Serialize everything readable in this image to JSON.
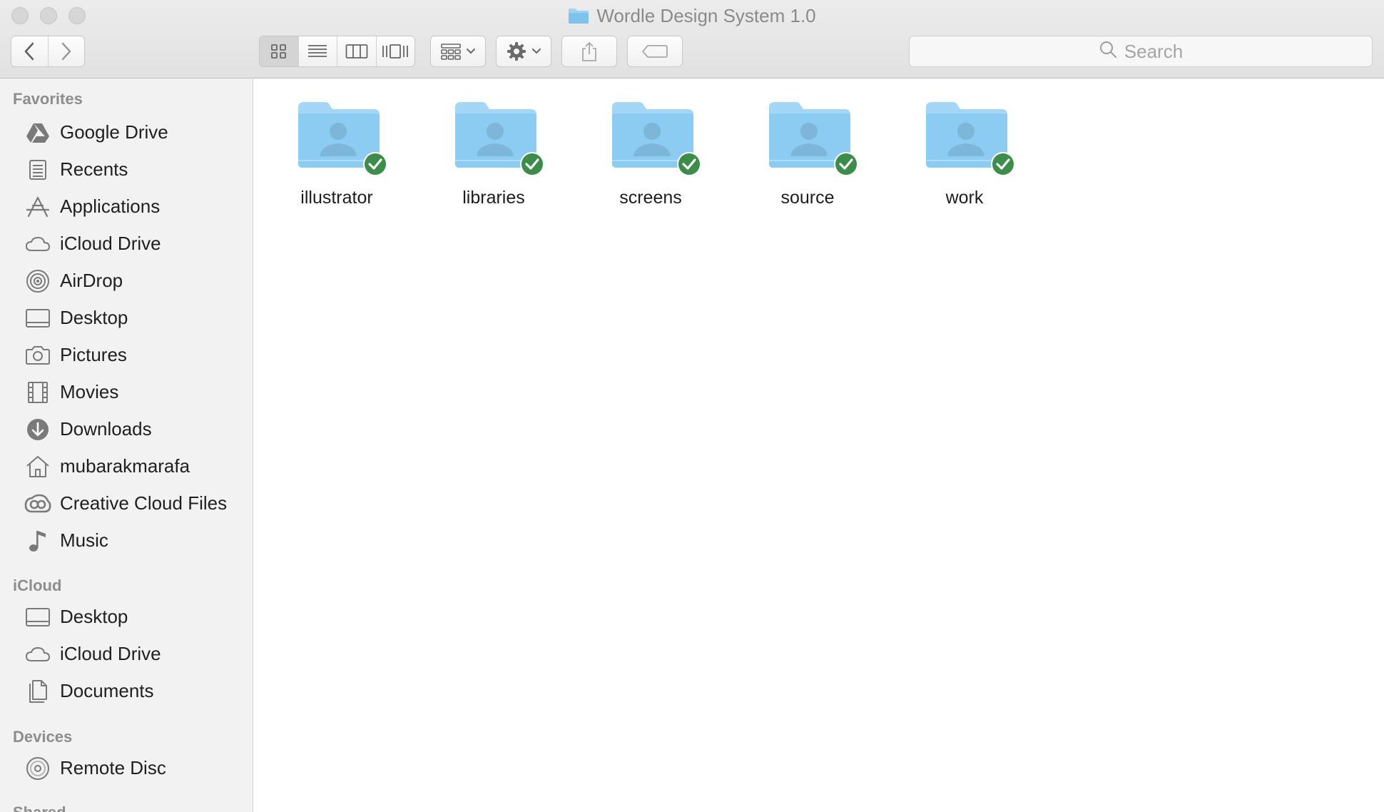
{
  "window": {
    "title": "Wordle Design System 1.0",
    "title_icon": "folder-icon"
  },
  "toolbar": {
    "back_icon": "chevron-left-icon",
    "forward_icon": "chevron-right-icon",
    "views": [
      "icon-view",
      "list-view",
      "column-view",
      "cover-flow-view"
    ],
    "active_view": "icon-view",
    "arrange_icon": "arrange-grid-icon",
    "action_icon": "gear-icon",
    "share_icon": "share-icon",
    "tag_icon": "tag-icon"
  },
  "search": {
    "placeholder": "Search"
  },
  "sidebar": {
    "favorites_title": "Favorites",
    "favorites": [
      {
        "label": "Google Drive",
        "icon": "google-drive-icon"
      },
      {
        "label": "Recents",
        "icon": "recents-icon"
      },
      {
        "label": "Applications",
        "icon": "applications-icon"
      },
      {
        "label": "iCloud Drive",
        "icon": "cloud-icon"
      },
      {
        "label": "AirDrop",
        "icon": "airdrop-icon"
      },
      {
        "label": "Desktop",
        "icon": "desktop-icon"
      },
      {
        "label": "Pictures",
        "icon": "camera-icon"
      },
      {
        "label": "Movies",
        "icon": "film-icon"
      },
      {
        "label": "Downloads",
        "icon": "download-icon"
      },
      {
        "label": "mubarakmarafa",
        "icon": "home-icon"
      },
      {
        "label": "Creative Cloud Files",
        "icon": "creative-cloud-icon"
      },
      {
        "label": "Music",
        "icon": "music-note-icon"
      }
    ],
    "icloud_title": "iCloud",
    "icloud": [
      {
        "label": "Desktop",
        "icon": "desktop-icon"
      },
      {
        "label": "iCloud Drive",
        "icon": "cloud-icon"
      },
      {
        "label": "Documents",
        "icon": "documents-icon"
      }
    ],
    "devices_title": "Devices",
    "devices": [
      {
        "label": "Remote Disc",
        "icon": "disc-icon"
      }
    ],
    "shared_title": "Shared"
  },
  "folders": [
    {
      "name": "illustrator",
      "synced": true
    },
    {
      "name": "libraries",
      "synced": true
    },
    {
      "name": "screens",
      "synced": true
    },
    {
      "name": "source",
      "synced": true
    },
    {
      "name": "work",
      "synced": true
    }
  ],
  "colors": {
    "folder": "#8ccbf2",
    "sync_badge": "#3c8c4a"
  }
}
